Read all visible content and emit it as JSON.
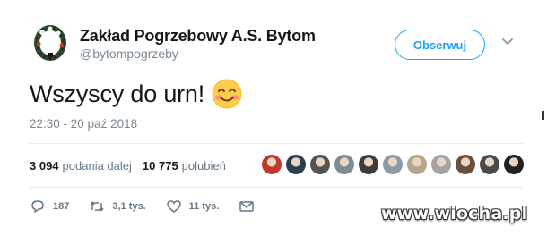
{
  "tweet": {
    "display_name": "Zakład Pogrzebowy A.S. Bytom",
    "handle": "@bytompogrzeby",
    "follow_label": "Obserwuj",
    "text": "Wszyscy do urn!",
    "emoji": "smiling-face-with-smiling-eyes",
    "timestamp": "22:30 - 20 paź 2018"
  },
  "stats": {
    "retweets_count": "3 094",
    "retweets_label": "podania dalej",
    "likes_count": "10 775",
    "likes_label": "polubień",
    "liker_avatar_colors": [
      "#c0392b",
      "#2c3e50",
      "#555555",
      "#7f8c8d",
      "#3d3d3d",
      "#8e9aa3",
      "#b7a48a",
      "#a3a3a3",
      "#6b4f3a",
      "#4a4a4a",
      "#222222"
    ]
  },
  "actions": {
    "reply_count": "187",
    "retweet_count": "3,1 tys.",
    "like_count": "11 tys."
  },
  "watermark": "www.wiocha.pl",
  "colors": {
    "accent": "#1da1f2",
    "muted": "#657786",
    "text": "#14171a"
  }
}
